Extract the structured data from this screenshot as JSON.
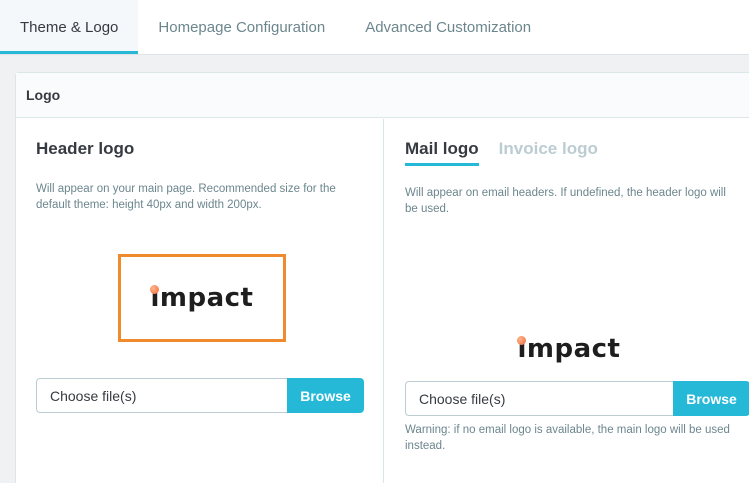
{
  "tabs": [
    {
      "label": "Theme & Logo",
      "active": true
    },
    {
      "label": "Homepage Configuration",
      "active": false
    },
    {
      "label": "Advanced Customization",
      "active": false
    }
  ],
  "card": {
    "title": "Logo",
    "header_logo": {
      "title": "Header logo",
      "help": "Will appear on your main page. Recommended size for the default theme: height 40px and width 200px.",
      "logo_text": "impact",
      "file_placeholder": "Choose file(s)",
      "browse_label": "Browse"
    },
    "mail_logo": {
      "subtabs": [
        {
          "label": "Mail logo",
          "active": true
        },
        {
          "label": "Invoice logo",
          "active": false
        }
      ],
      "help": "Will appear on email headers. If undefined, the header logo will be used.",
      "logo_text": "impact",
      "file_placeholder": "Choose file(s)",
      "browse_label": "Browse",
      "warning": "Warning: if no email logo is available, the main logo will be used instead."
    }
  },
  "colors": {
    "accent": "#25b9d7",
    "highlight_frame": "#f08a2e"
  }
}
